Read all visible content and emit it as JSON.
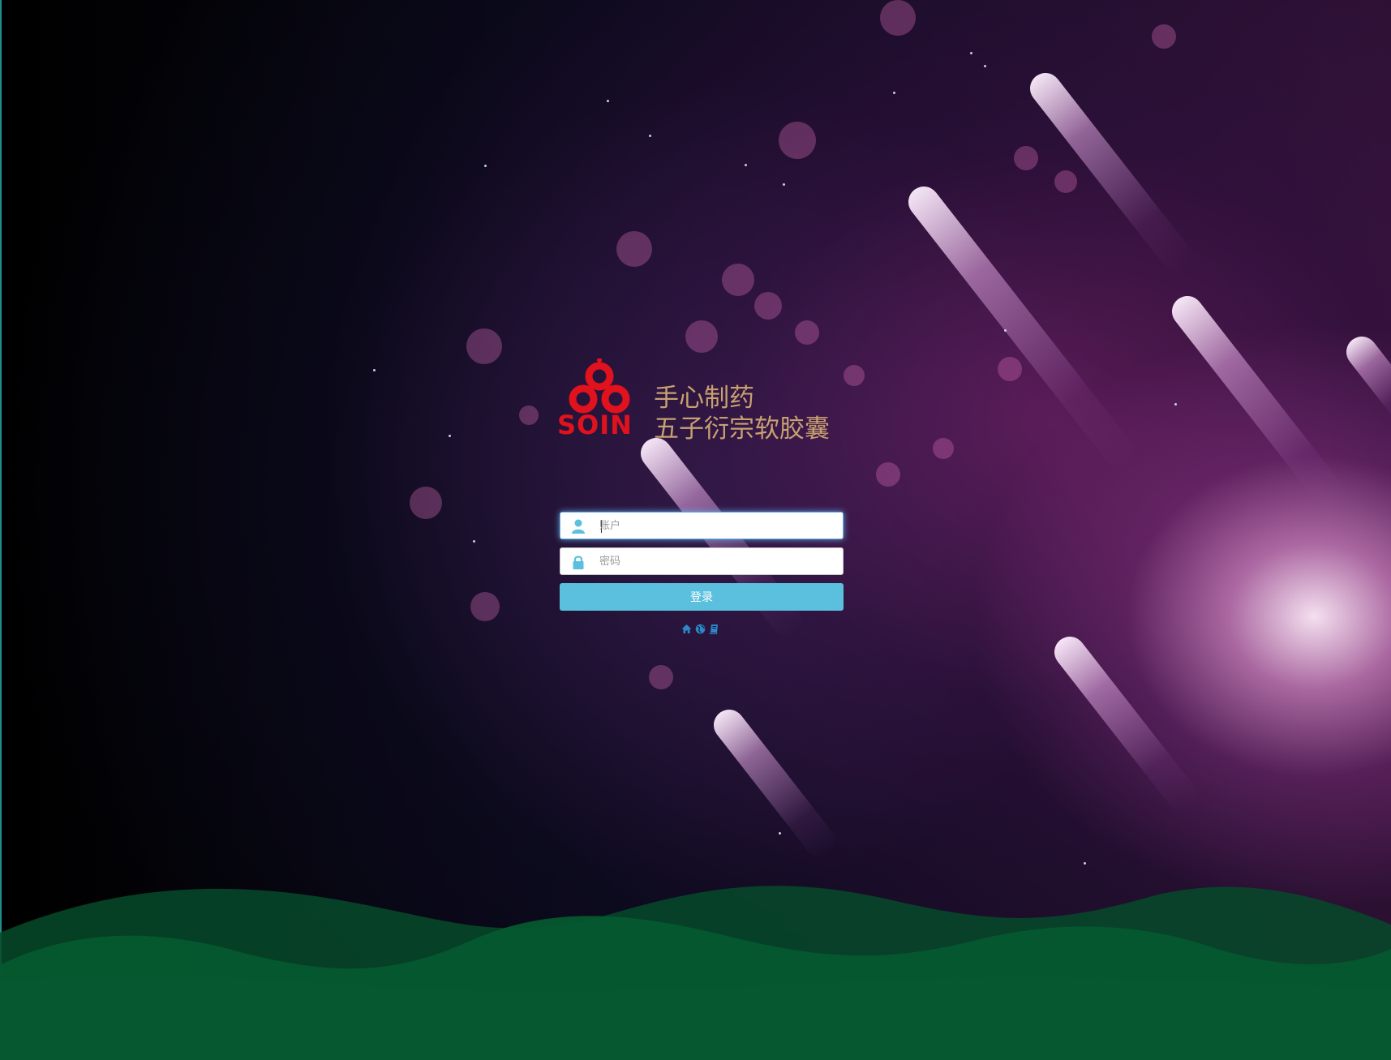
{
  "brand": {
    "logo_text": "SOIN",
    "line1": "手心制药",
    "line2": "五子衍宗软胶囊",
    "logo_color": "#e0121e",
    "tagline_color": "#c8a070"
  },
  "form": {
    "account_placeholder": "账户",
    "account_value": "",
    "password_placeholder": "密码",
    "password_value": "",
    "login_label": "登录",
    "input_icon_color": "#5bc0de",
    "button_color": "#5bc0de"
  },
  "footer_links": [
    {
      "icon": "home-icon"
    },
    {
      "icon": "globe-icon"
    },
    {
      "icon": "book-icon"
    }
  ],
  "background": {
    "wave_color": "#05582f"
  }
}
